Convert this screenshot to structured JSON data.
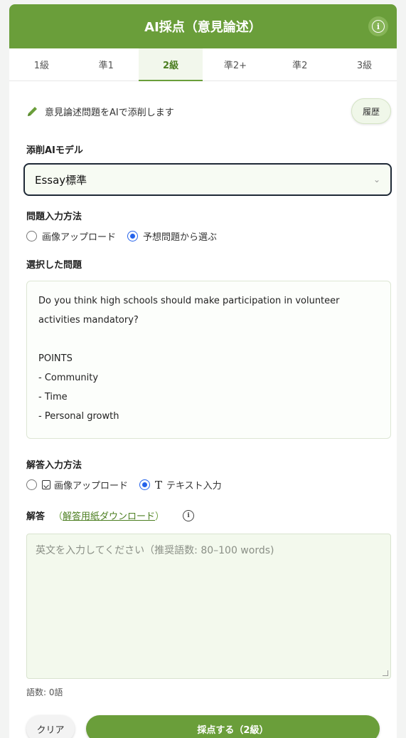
{
  "header": {
    "title": "AI採点（意見論述）",
    "info_icon": "info-icon"
  },
  "tabs": [
    "1級",
    "準1",
    "2級",
    "準2+",
    "準2",
    "3級"
  ],
  "active_tab": "2級",
  "intro": {
    "text": "意見論述問題をAIで添削します",
    "icon": "pencil-icon",
    "history_label": "履歴"
  },
  "model": {
    "label": "添削AIモデル",
    "selected": "Essay標準"
  },
  "question_input": {
    "label": "問題入力方法",
    "options": [
      "画像アップロード",
      "予想問題から選ぶ"
    ],
    "selected": "予想問題から選ぶ"
  },
  "selected_problem": {
    "label": "選択した問題",
    "question": "Do you think high schools should make participation in volunteer activities mandatory?",
    "points_title": "POINTS",
    "points": [
      "- Community",
      "- Time",
      "- Personal growth"
    ]
  },
  "answer_input": {
    "label": "解答入力方法",
    "options": [
      "画像アップロード",
      "テキスト入力"
    ],
    "selected": "テキスト入力"
  },
  "answer": {
    "label": "解答",
    "download_open": "（",
    "download_link": "解答用紙ダウンロード",
    "download_close": "）",
    "placeholder": "英文を入力してください（推奨語数: 80–100 words)",
    "value": "",
    "wordcount": "語数: 0語"
  },
  "actions": {
    "clear_label": "クリア",
    "submit_label": "採点する（2級）"
  },
  "colors": {
    "accent": "#6a9e3a",
    "radio": "#2563eb"
  }
}
